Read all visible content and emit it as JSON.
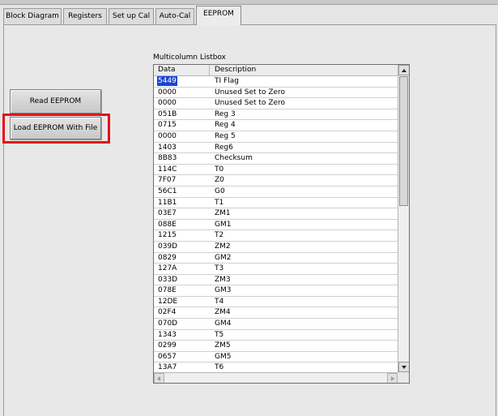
{
  "tabs": [
    {
      "label": "Block Diagram"
    },
    {
      "label": "Registers"
    },
    {
      "label": "Set up Cal"
    },
    {
      "label": "Auto-Cal"
    },
    {
      "label": "EEPROM",
      "active": true
    }
  ],
  "buttons": {
    "read_label": "Read EEPROM",
    "load_label": "Load EEPROM With File"
  },
  "highlight_color": "#e0141c",
  "listbox": {
    "caption": "Multicolumn Listbox",
    "columns": [
      "Data",
      "Description"
    ],
    "selected_row": 0,
    "rows": [
      {
        "data": "5449",
        "desc": "TI Flag"
      },
      {
        "data": "0000",
        "desc": "Unused Set to Zero"
      },
      {
        "data": "0000",
        "desc": "Unused Set to Zero"
      },
      {
        "data": "051B",
        "desc": "Reg 3"
      },
      {
        "data": "0715",
        "desc": "Reg 4"
      },
      {
        "data": "0000",
        "desc": "Reg 5"
      },
      {
        "data": "1403",
        "desc": "Reg6"
      },
      {
        "data": "8B83",
        "desc": "Checksum"
      },
      {
        "data": "114C",
        "desc": "T0"
      },
      {
        "data": "7F07",
        "desc": "Z0"
      },
      {
        "data": "56C1",
        "desc": "G0"
      },
      {
        "data": "11B1",
        "desc": "T1"
      },
      {
        "data": "03E7",
        "desc": "ZM1"
      },
      {
        "data": "088E",
        "desc": "GM1"
      },
      {
        "data": "1215",
        "desc": "T2"
      },
      {
        "data": "039D",
        "desc": "ZM2"
      },
      {
        "data": "0829",
        "desc": "GM2"
      },
      {
        "data": "127A",
        "desc": "T3"
      },
      {
        "data": "033D",
        "desc": "ZM3"
      },
      {
        "data": "078E",
        "desc": "GM3"
      },
      {
        "data": "12DE",
        "desc": "T4"
      },
      {
        "data": "02F4",
        "desc": "ZM4"
      },
      {
        "data": "070D",
        "desc": "GM4"
      },
      {
        "data": "1343",
        "desc": "T5"
      },
      {
        "data": "0299",
        "desc": "ZM5"
      },
      {
        "data": "0657",
        "desc": "GM5"
      },
      {
        "data": "13A7",
        "desc": "T6"
      }
    ]
  }
}
